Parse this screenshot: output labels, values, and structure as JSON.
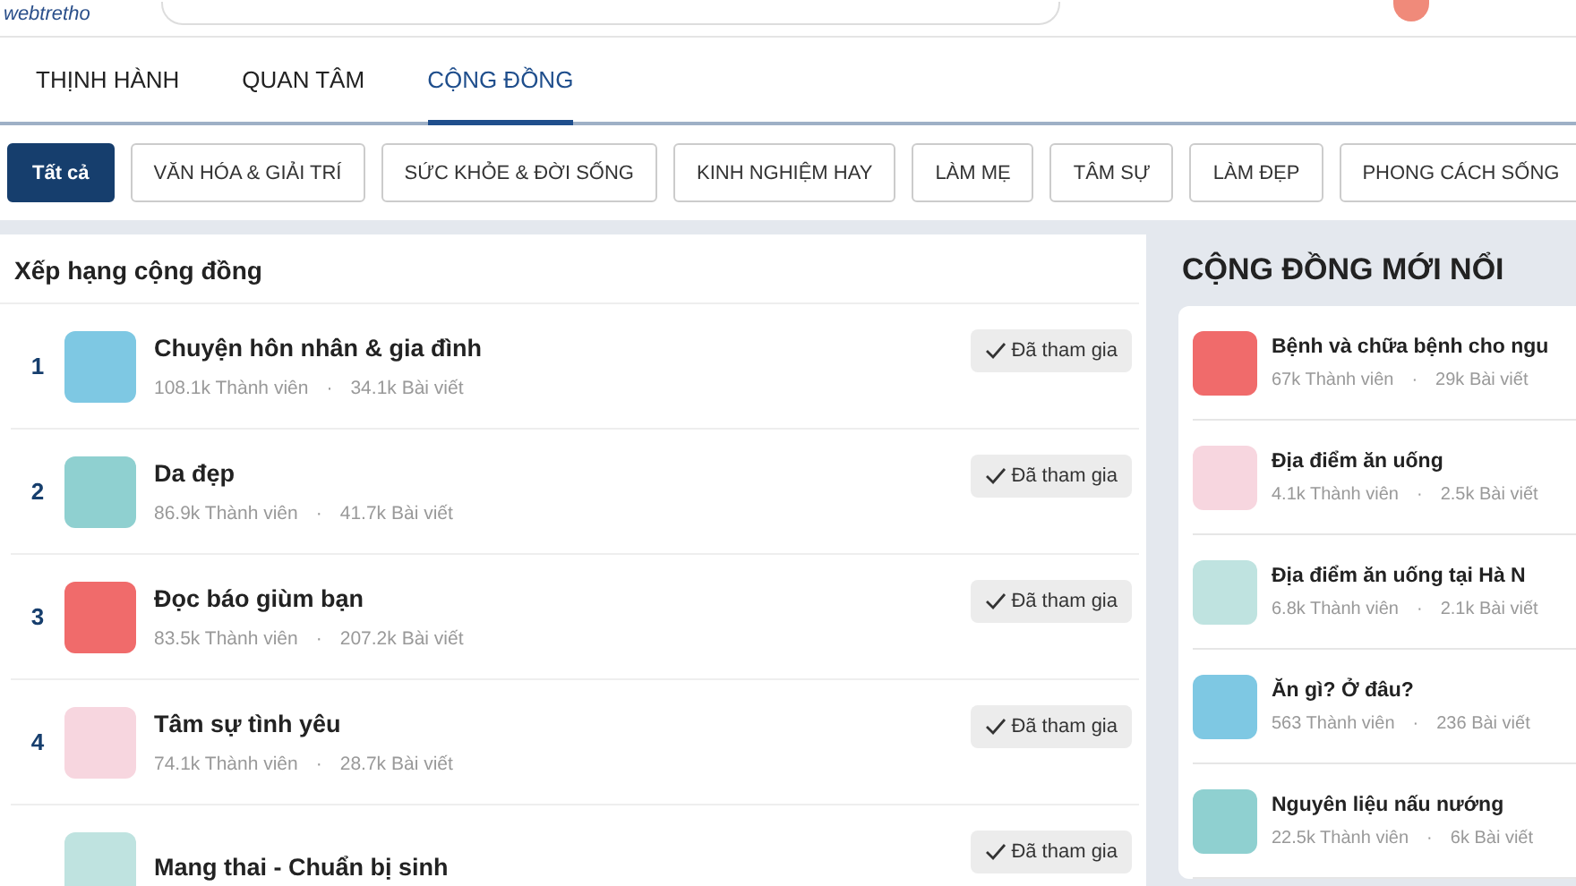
{
  "header": {
    "logo": "webtretho"
  },
  "tabs": [
    {
      "label": "THỊNH HÀNH",
      "selected": false
    },
    {
      "label": "QUAN TÂM",
      "selected": false
    },
    {
      "label": "CỘNG ĐỒNG",
      "selected": true
    }
  ],
  "categories": [
    {
      "label": "Tất cả",
      "selected": true
    },
    {
      "label": "VĂN HÓA & GIẢI TRÍ",
      "selected": false
    },
    {
      "label": "SỨC KHỎE & ĐỜI SỐNG",
      "selected": false
    },
    {
      "label": "KINH NGHIỆM HAY",
      "selected": false
    },
    {
      "label": "LÀM MẸ",
      "selected": false
    },
    {
      "label": "TÂM SỰ",
      "selected": false
    },
    {
      "label": "LÀM ĐẸP",
      "selected": false
    },
    {
      "label": "PHONG CÁCH SỐNG",
      "selected": false
    }
  ],
  "separator": "·",
  "ranking": {
    "title": "Xếp hạng cộng đồng",
    "items": [
      {
        "rank": "1",
        "name": "Chuyện hôn nhân & gia đình",
        "members": "108.1k Thành viên",
        "posts": "34.1k Bài viết",
        "button": "Đã tham gia"
      },
      {
        "rank": "2",
        "name": "Da đẹp",
        "members": "86.9k Thành viên",
        "posts": "41.7k Bài viết",
        "button": "Đã tham gia"
      },
      {
        "rank": "3",
        "name": "Đọc báo giùm bạn",
        "members": "83.5k Thành viên",
        "posts": "207.2k Bài viết",
        "button": "Đã tham gia"
      },
      {
        "rank": "4",
        "name": "Tâm sự tình yêu",
        "members": "74.1k Thành viên",
        "posts": "28.7k Bài viết",
        "button": "Đã tham gia"
      },
      {
        "name": "Mang thai - Chuẩn bị sinh",
        "button": "Đã tham gia"
      }
    ]
  },
  "emerging": {
    "title": "CỘNG ĐỒNG MỚI NỔI",
    "items": [
      {
        "name": "Bệnh và chữa bệnh cho ngu",
        "members": "67k Thành viên",
        "posts": "29k Bài viết"
      },
      {
        "name": "Địa điểm ăn uống",
        "members": "4.1k Thành viên",
        "posts": "2.5k Bài viết"
      },
      {
        "name": "Địa điểm ăn uống tại Hà N",
        "members": "6.8k Thành viên",
        "posts": "2.1k Bài viết"
      },
      {
        "name": "Ăn gì? Ở đâu?",
        "members": "563 Thành viên",
        "posts": "236 Bài viết"
      },
      {
        "name": "Nguyên liệu nấu nướng",
        "members": "22.5k Thành viên",
        "posts": "6k Bài viết"
      }
    ]
  }
}
